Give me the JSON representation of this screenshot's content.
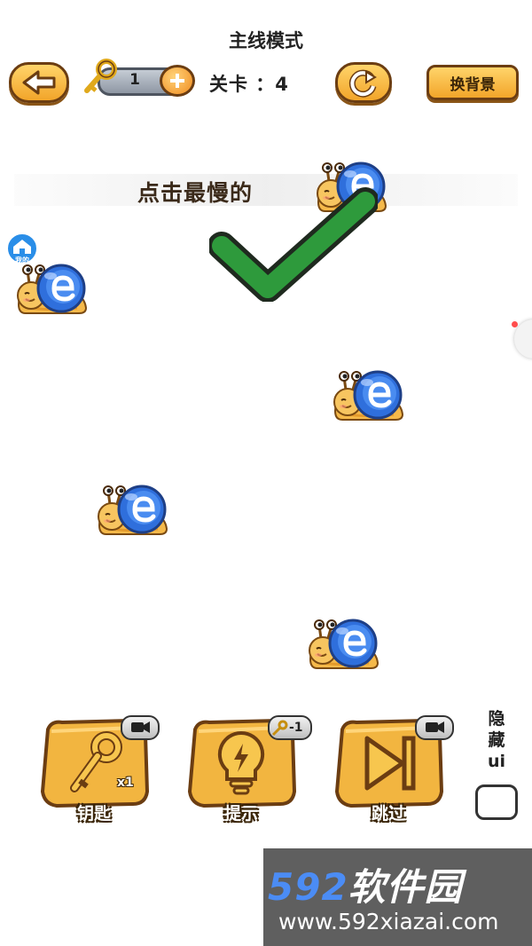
{
  "header": {
    "mode_title": "主线模式",
    "key_count": "1",
    "level_text": "关卡 ：4",
    "change_bg_label": "换背景"
  },
  "game": {
    "instruction": "点击最慢的",
    "snail_count": 5,
    "result": "correct"
  },
  "icons": {
    "back": "back-arrow-icon",
    "key": "key-icon",
    "add": "plus-icon",
    "restart": "restart-icon",
    "check": "checkmark-icon",
    "video": "video-icon",
    "hint": "lightbulb-icon",
    "skip": "skip-icon",
    "home": "home-badge-icon"
  },
  "home_badge": {
    "label": "我的"
  },
  "toolbar": {
    "key_label": "钥匙",
    "key_multiplier": "x1",
    "hint_label": "提示",
    "hint_cost": "-1",
    "skip_label": "跳过"
  },
  "hide_ui": {
    "label_line1": "隐",
    "label_line2": "藏",
    "label_line3": "ui"
  },
  "watermark": {
    "brand_num": "592",
    "brand_cn": "软件园",
    "url": "www.592xiazai.com"
  },
  "colors": {
    "tile": "#f2b540",
    "tile_border": "#6b3d12",
    "check": "#2e9a3c",
    "snail_shell": "#2f6fdc",
    "watermark_bg": "#5f5f5f",
    "watermark_blue": "#4b8cf5"
  }
}
